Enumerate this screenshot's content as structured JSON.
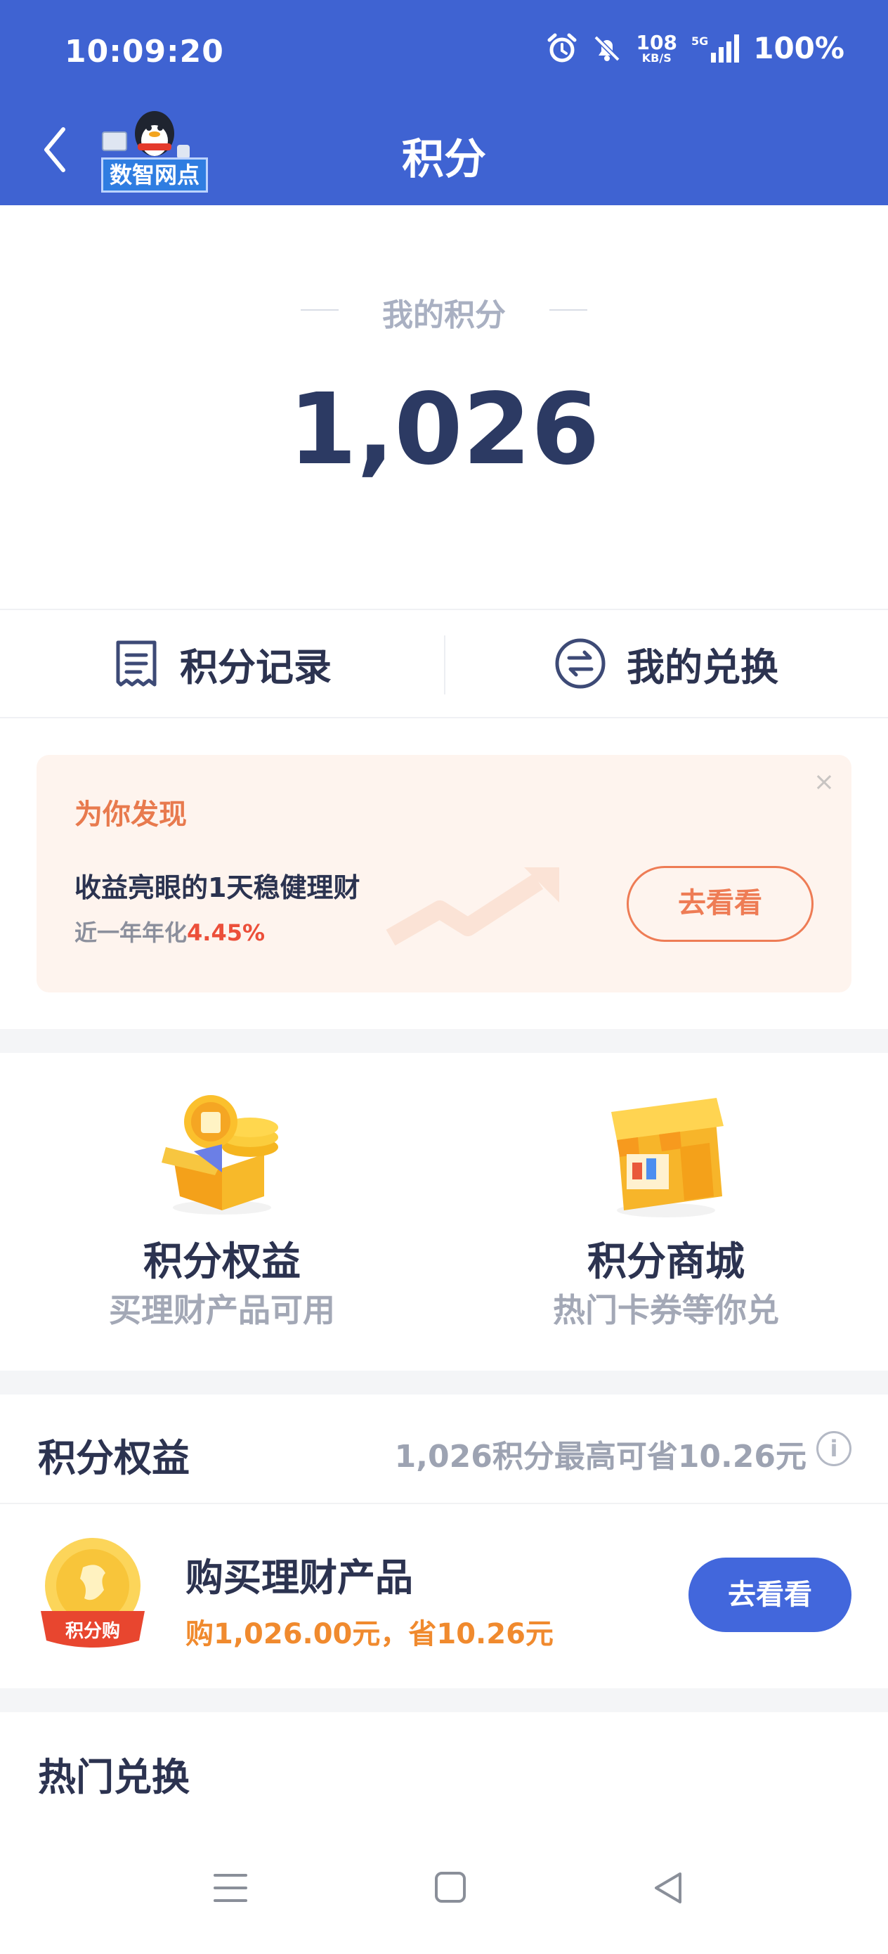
{
  "status_bar": {
    "time": "10:09:20",
    "speed_value": "108",
    "speed_unit": "KB/S",
    "network": "5G",
    "battery": "100%"
  },
  "header": {
    "title": "积分",
    "logo_text": "数智网点"
  },
  "points": {
    "label": "我的积分",
    "value": "1,026"
  },
  "tabs": {
    "records_label": "积分记录",
    "exchange_label": "我的兑换"
  },
  "promo": {
    "title": "为你发现",
    "subtitle": "收益亮眼的1天稳健理财",
    "rate_prefix": "近一年年化",
    "rate_value": "4.45%",
    "button_label": "去看看",
    "close_symbol": "×"
  },
  "features": [
    {
      "title": "积分权益",
      "subtitle": "买理财产品可用"
    },
    {
      "title": "积分商城",
      "subtitle": "热门卡券等你兑"
    }
  ],
  "benefits": {
    "heading": "积分权益",
    "note": "1,026积分最高可省10.26元",
    "info_symbol": "i",
    "product": {
      "badge": "积分购",
      "title": "购买理财产品",
      "subtitle": "购1,026.00元，省10.26元",
      "button_label": "去看看"
    }
  },
  "hot_exchange": {
    "heading": "热门兑换"
  },
  "colors": {
    "brand_blue": "#3f63d2",
    "accent_orange": "#ee7c55",
    "rate_red": "#ec4f3a",
    "text_dark": "#2c3350"
  }
}
